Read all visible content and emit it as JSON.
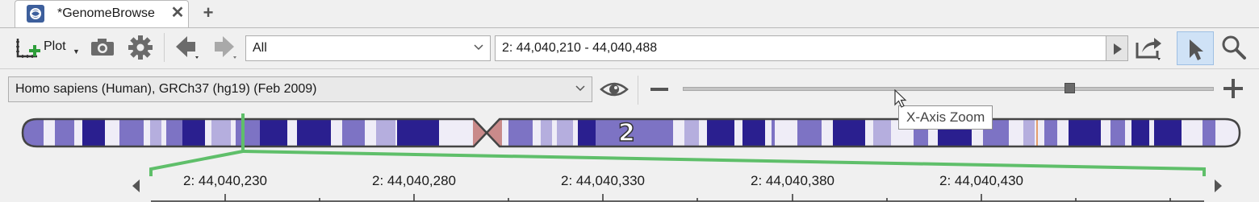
{
  "tab": {
    "title": "*GenomeBrowse",
    "close_symbol": "✕",
    "new_tab_symbol": "+"
  },
  "toolbar": {
    "plot_label": "Plot",
    "track_filter": {
      "value": "All"
    },
    "locus": {
      "value": "2: 44,040,210 - 44,040,488"
    }
  },
  "genome_selector": {
    "value": "Homo sapiens (Human), GRCh37 (hg19) (Feb 2009)"
  },
  "zoom": {
    "slider_level": 0.73,
    "tooltip": "X-Axis Zoom"
  },
  "ideogram": {
    "chromosome": "2"
  },
  "ruler": {
    "ticks": [
      "2: 44,040,230",
      "2: 44,040,280",
      "2: 44,040,330",
      "2: 44,040,380",
      "2: 44,040,430"
    ]
  },
  "colors": {
    "accent_selected": "#cfe2f6",
    "band_dark": "#2a1f8f",
    "band_mid": "#7d73c4",
    "band_light": "#b5aede",
    "centromere": "#c98a8a",
    "region_highlight": "#5fbf6a"
  },
  "icons": {
    "tab": "genome-app-icon",
    "plot": "add-plot-icon",
    "camera": "camera-icon",
    "settings": "gear-icon",
    "back": "back-arrow-icon",
    "forward": "forward-arrow-icon",
    "go": "play-icon",
    "export": "export-icon",
    "select": "pointer-icon",
    "search": "magnifier-icon",
    "visibility": "eye-icon"
  }
}
